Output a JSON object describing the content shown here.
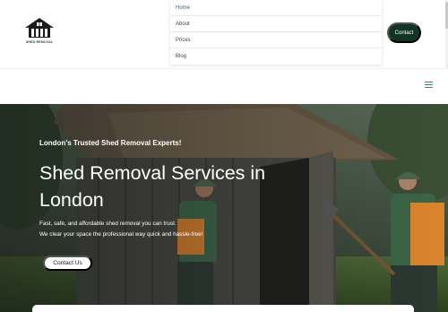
{
  "brand": {
    "logo_text": "SHED REMOVAL"
  },
  "nav": {
    "items": [
      {
        "label": "Home",
        "active": true
      },
      {
        "label": "About",
        "active": false
      },
      {
        "label": "Prices",
        "active": false
      },
      {
        "label": "Blog",
        "active": false
      }
    ],
    "contact_label": "Contact"
  },
  "mobile_header": {
    "menu_icon": "hamburger-icon"
  },
  "hero": {
    "tagline": "London's Trusted Shed Removal Experts!",
    "title": "Shed Removal Services in London",
    "description_lines": [
      "Fast, safe, and affordable shed removal you can trust.",
      "We clear your space the professional way quick and hassle-free!"
    ],
    "cta_label": "Contact Us"
  },
  "colors": {
    "brand_dark_green": "#113524",
    "menu_accent": "#2b8c7f",
    "nav_active": "#2d6a7c"
  }
}
